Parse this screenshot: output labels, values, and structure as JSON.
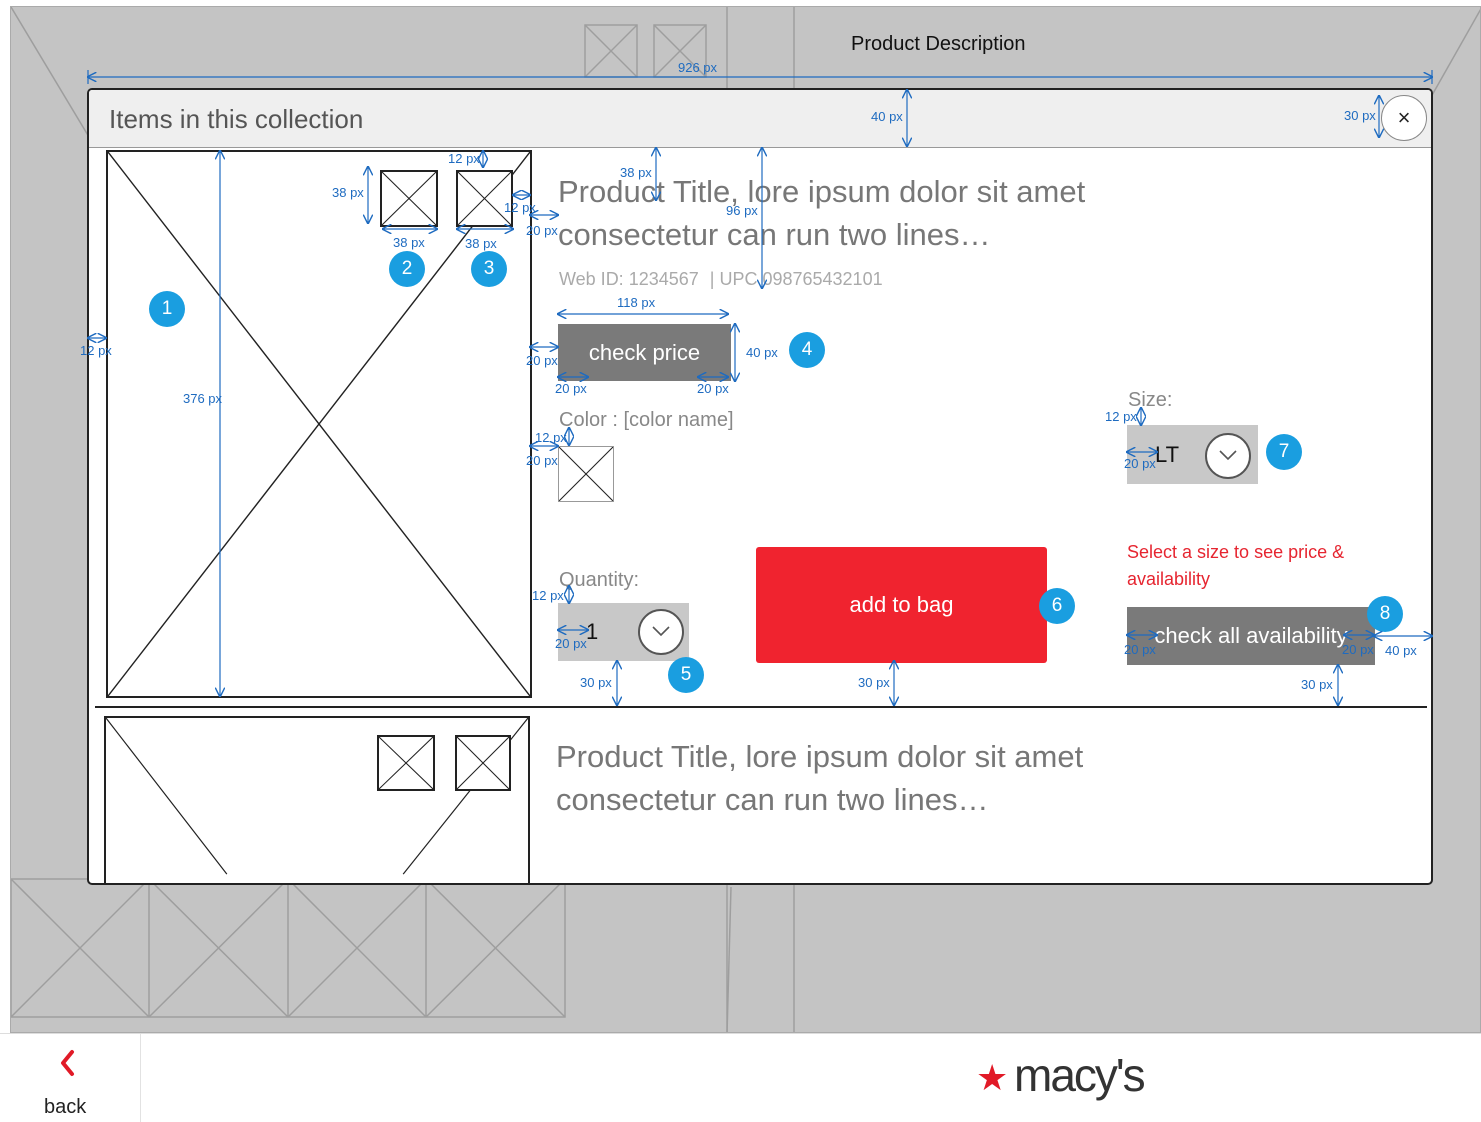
{
  "background": {
    "title": "Product Description"
  },
  "dialog": {
    "title": "Items in this collection",
    "close_label": "×"
  },
  "product1": {
    "title_line1": "Product Title, lore ipsum dolor sit amet",
    "title_line2": "consectetur can run two lines…",
    "web_id": "Web ID: 1234567",
    "upc": "| UPC 098765432101",
    "check_price_label": "check price",
    "color_label": "Color : [color name]",
    "size_label": "Size:",
    "size_value": "LT",
    "quantity_label": "Quantity:",
    "quantity_value": "1",
    "add_to_bag_label": "add to bag",
    "size_warning": "Select a size to see price & availability",
    "check_availability_label": "check all availability"
  },
  "product2": {
    "title_line1": "Product Title, lore ipsum dolor sit amet",
    "title_line2": "consectetur can run two lines…"
  },
  "badges": [
    "1",
    "2",
    "3",
    "4",
    "5",
    "6",
    "7",
    "8"
  ],
  "annotations": {
    "width_926": "926 px",
    "h40_header": "40 px",
    "close_30": "30 px",
    "main_image_376": "376 px",
    "margin_12_left": "12 px",
    "thumb_38_h": "38 px",
    "thumb_38_w1": "38 px",
    "thumb_38_w2": "38 px",
    "thumb_12_top": "12 px",
    "thumb_12_right": "12 px",
    "gap_20": "20 px",
    "title_38": "38 px",
    "title_96": "96 px",
    "check_price_118": "118 px",
    "check_price_40": "40 px",
    "check_price_20_left": "20 px",
    "check_price_pad_l": "20 px",
    "check_price_pad_r": "20 px",
    "swatch_12": "12 px",
    "swatch_20": "20 px",
    "qty_12": "12 px",
    "qty_20": "20 px",
    "qty_30": "30 px",
    "bag_30": "30 px",
    "size_12": "12 px",
    "size_20": "20 px",
    "avail_20_l": "20 px",
    "avail_20_r": "20 px",
    "avail_40": "40 px",
    "avail_30": "30 px"
  },
  "footer": {
    "back_label": "back",
    "logo_text": "macy's",
    "brand_color": "#e11a27"
  },
  "colors": {
    "accent_red": "#f0232f",
    "annotation_blue": "#1e6bc0",
    "badge_blue": "#1a9ee0",
    "gray_button": "#7a7a7a"
  }
}
